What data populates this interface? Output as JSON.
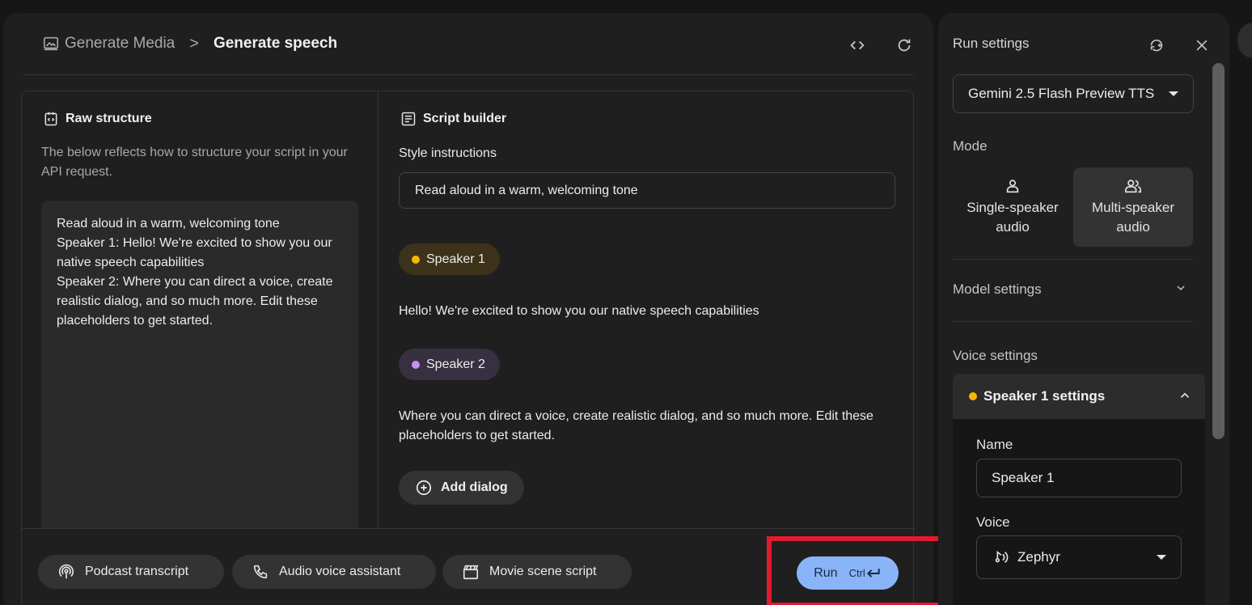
{
  "breadcrumb": {
    "parent": "Generate Media",
    "separator": ">",
    "current": "Generate speech"
  },
  "raw_structure": {
    "title": "Raw structure",
    "description": "The below reflects how to structure your script in your API request.",
    "lines": [
      "Read aloud in a warm, welcoming tone",
      "Speaker 1: Hello! We're excited to show you our native speech capabilities",
      "Speaker 2: Where you can direct a voice, create realistic dialog, and so much more. Edit these placeholders to get started."
    ]
  },
  "script_builder": {
    "title": "Script builder",
    "style_label": "Style instructions",
    "style_value": "Read aloud in a warm, welcoming tone",
    "speakers": [
      {
        "name": "Speaker 1",
        "color": "#f5b800",
        "text": "Hello! We're excited to show you our native speech capabilities"
      },
      {
        "name": "Speaker 2",
        "color": "#c291f2",
        "text": "Where you can direct a voice, create realistic dialog, and so much more. Edit these placeholders to get started."
      }
    ],
    "add_dialog_label": "Add dialog"
  },
  "presets": [
    {
      "label": "Podcast transcript",
      "icon": "podcast-icon"
    },
    {
      "label": "Audio voice assistant",
      "icon": "phone-icon"
    },
    {
      "label": "Movie scene script",
      "icon": "clapperboard-icon"
    }
  ],
  "run": {
    "label": "Run",
    "shortcut": "Ctrl",
    "accent": "#8ab4f8"
  },
  "run_settings": {
    "title": "Run settings",
    "model": "Gemini 2.5 Flash Preview TTS",
    "mode_label": "Mode",
    "modes": [
      {
        "label": "Single-speaker audio",
        "selected": false
      },
      {
        "label": "Multi-speaker audio",
        "selected": true
      }
    ],
    "model_settings_label": "Model settings",
    "voice_settings_label": "Voice settings",
    "speaker_settings": {
      "title": "Speaker 1 settings",
      "name_label": "Name",
      "name_value": "Speaker 1",
      "voice_label": "Voice",
      "voice_value": "Zephyr"
    }
  }
}
